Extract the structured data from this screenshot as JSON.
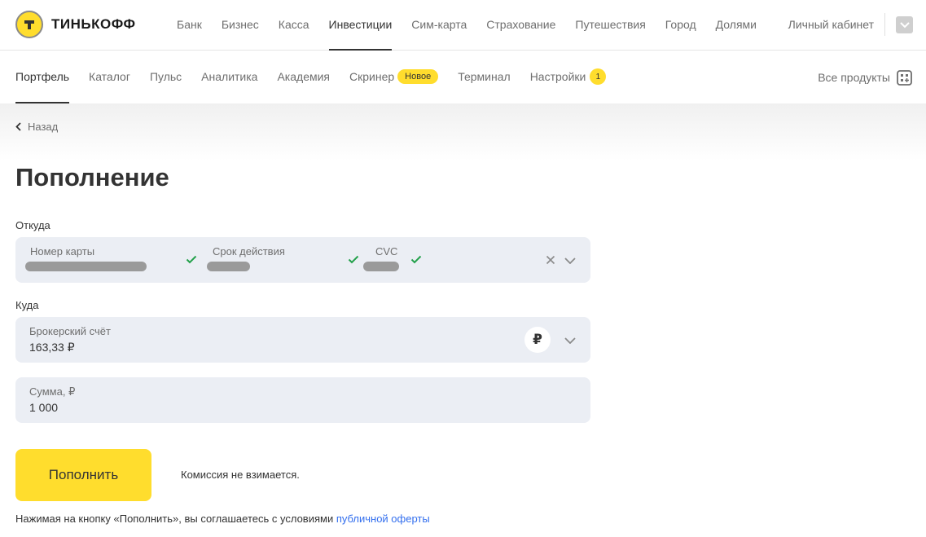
{
  "brand": {
    "name": "ТИНЬКОФФ",
    "accent": "#ffdd2d",
    "link_color": "#336fee"
  },
  "top_nav": {
    "items": [
      {
        "label": "Банк",
        "active": false
      },
      {
        "label": "Бизнес",
        "active": false
      },
      {
        "label": "Касса",
        "active": false
      },
      {
        "label": "Инвестиции",
        "active": true
      },
      {
        "label": "Сим-карта",
        "active": false
      },
      {
        "label": "Страхование",
        "active": false
      },
      {
        "label": "Путешествия",
        "active": false
      },
      {
        "label": "Город",
        "active": false
      },
      {
        "label": "Долями",
        "active": false
      }
    ],
    "cabinet_label": "Личный кабинет",
    "profile_icon": "chevron-down-icon"
  },
  "sub_nav": {
    "items": [
      {
        "label": "Портфель",
        "active": true
      },
      {
        "label": "Каталог"
      },
      {
        "label": "Пульс"
      },
      {
        "label": "Аналитика"
      },
      {
        "label": "Академия"
      },
      {
        "label": "Скринер",
        "badge": "Новое"
      },
      {
        "label": "Терминал"
      },
      {
        "label": "Настройки",
        "count": "1"
      }
    ],
    "all_products_label": "Все продукты"
  },
  "back_label": "Назад",
  "page_title": "Пополнение",
  "from": {
    "label": "Откуда",
    "card_number_label": "Номер карты",
    "expiry_label": "Срок действия",
    "cvc_label": "CVC"
  },
  "to": {
    "label": "Куда",
    "account_label": "Брокерский счёт",
    "account_value": "163,33 ₽",
    "currency_symbol": "₽"
  },
  "amount": {
    "label": "Сумма, ₽",
    "value": "1 000"
  },
  "submit_label": "Пополнить",
  "fee_text": "Комиссия не взимается.",
  "terms": {
    "text": "Нажимая на кнопку «Пополнить», вы соглашаетесь с условиями",
    "link": "публичной оферты"
  }
}
